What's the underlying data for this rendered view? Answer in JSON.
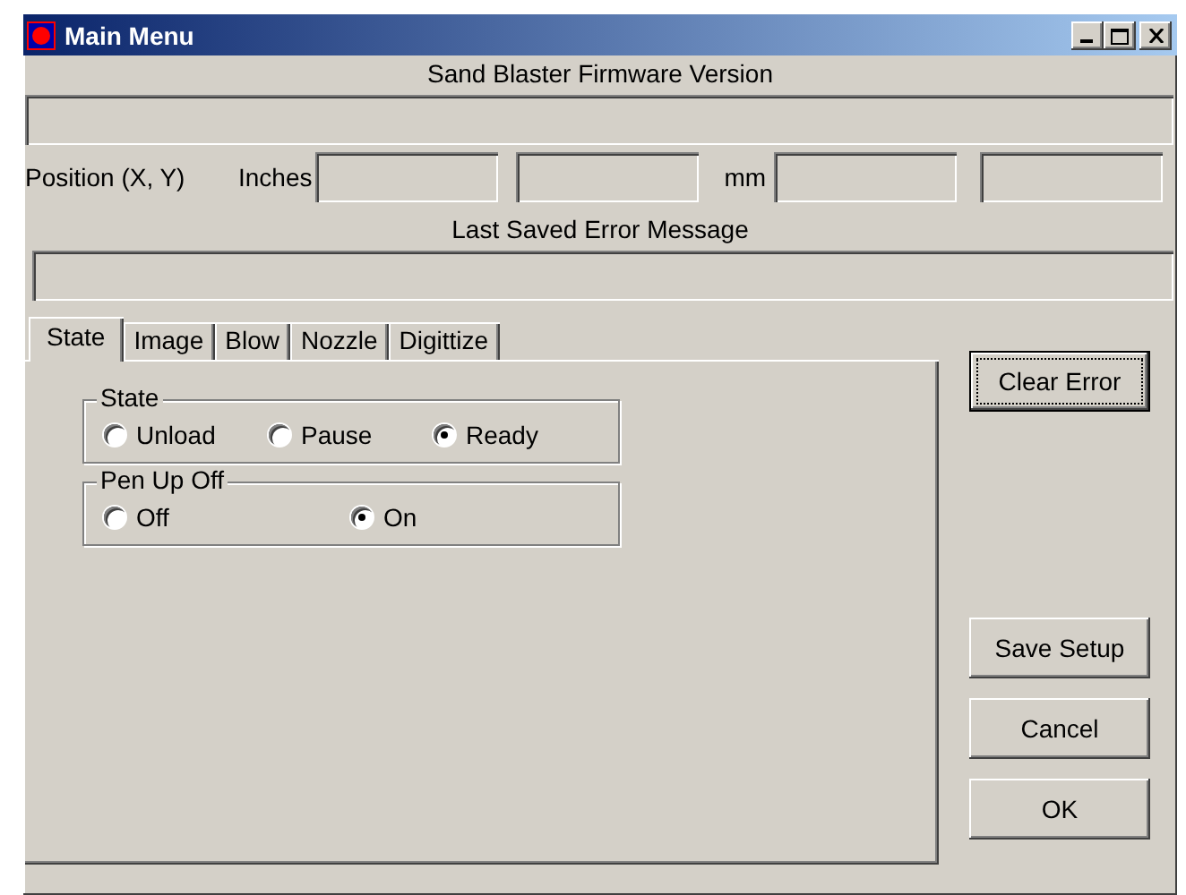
{
  "window": {
    "title": "Main Menu"
  },
  "firmware": {
    "label": "Sand Blaster Firmware Version"
  },
  "position": {
    "label": "Position (X, Y)",
    "inches_label": "Inches",
    "mm_label": "mm"
  },
  "error_message": {
    "label": "Last Saved Error Message"
  },
  "tabs": [
    {
      "label": "State",
      "selected": true
    },
    {
      "label": "Image",
      "selected": false
    },
    {
      "label": "Blow",
      "selected": false
    },
    {
      "label": "Nozzle",
      "selected": false
    },
    {
      "label": "Digittize",
      "selected": false
    }
  ],
  "groups": [
    {
      "title": "State",
      "options": [
        {
          "label": "Unload",
          "selected": false
        },
        {
          "label": "Pause",
          "selected": false
        },
        {
          "label": "Ready",
          "selected": true
        }
      ]
    },
    {
      "title": "Pen Up Off",
      "options": [
        {
          "label": "Off",
          "selected": false
        },
        {
          "label": "On",
          "selected": true
        }
      ]
    }
  ],
  "buttons": [
    {
      "label": "Clear Error",
      "focused": true
    },
    {
      "label": "Save Setup",
      "focused": false
    },
    {
      "label": "Cancel",
      "focused": false
    },
    {
      "label": "OK",
      "focused": false
    }
  ]
}
